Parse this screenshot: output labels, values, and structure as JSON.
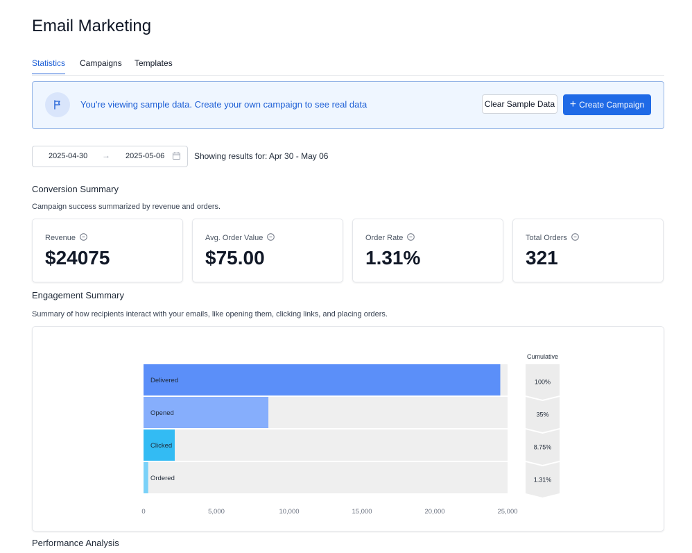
{
  "page": {
    "title": "Email Marketing"
  },
  "tabs": [
    {
      "label": "Statistics",
      "active": true
    },
    {
      "label": "Campaigns",
      "active": false
    },
    {
      "label": "Templates",
      "active": false
    }
  ],
  "banner": {
    "icon": "flag-icon",
    "text": "You're viewing sample data. Create your own campaign to see real data",
    "clear_label": "Clear Sample Data",
    "create_label": "Create Campaign",
    "create_icon": "plus-icon"
  },
  "date_range": {
    "start": "2025-04-30",
    "end": "2025-05-06",
    "arrow_icon": "arrow-right-icon",
    "calendar_icon": "calendar-icon",
    "showing": "Showing results for: Apr 30 - May 06"
  },
  "conversion": {
    "title": "Conversion Summary",
    "description": "Campaign success summarized by revenue and orders.",
    "cards": [
      {
        "label": "Revenue",
        "value": "$24075"
      },
      {
        "label": "Avg. Order Value",
        "value": "$75.00"
      },
      {
        "label": "Order Rate",
        "value": "1.31%"
      },
      {
        "label": "Total Orders",
        "value": "321"
      }
    ]
  },
  "engagement": {
    "title": "Engagement Summary",
    "description": "Summary of how recipients interact with your emails, like opening them, clicking links, and placing orders."
  },
  "performance": {
    "title": "Performance Analysis"
  },
  "colors": {
    "accent": "#1f6ae6",
    "delivered": "#5b8ff9",
    "opened": "#86aefc",
    "clicked": "#33bbf3",
    "ordered": "#7ad1f8",
    "track": "#efefef",
    "cumulative": "#ececec"
  },
  "chart_data": {
    "type": "bar",
    "orientation": "horizontal",
    "categories": [
      "Delivered",
      "Opened",
      "Clicked",
      "Ordered"
    ],
    "values": [
      24500,
      8575,
      2144,
      321
    ],
    "xlim": [
      0,
      25000
    ],
    "xticks": [
      "0",
      "5,000",
      "10,000",
      "15,000",
      "20,000",
      "25,000"
    ],
    "cumulative_title": "Cumulative",
    "cumulative": [
      "100%",
      "35%",
      "8.75%",
      "1.31%"
    ]
  }
}
